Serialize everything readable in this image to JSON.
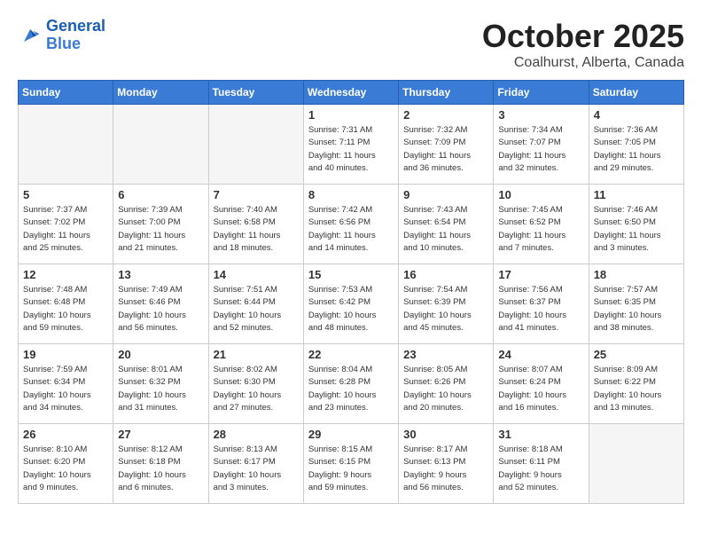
{
  "header": {
    "logo_line1": "General",
    "logo_line2": "Blue",
    "month": "October 2025",
    "location": "Coalhurst, Alberta, Canada"
  },
  "weekdays": [
    "Sunday",
    "Monday",
    "Tuesday",
    "Wednesday",
    "Thursday",
    "Friday",
    "Saturday"
  ],
  "weeks": [
    [
      {
        "day": "",
        "info": ""
      },
      {
        "day": "",
        "info": ""
      },
      {
        "day": "",
        "info": ""
      },
      {
        "day": "1",
        "info": "Sunrise: 7:31 AM\nSunset: 7:11 PM\nDaylight: 11 hours\nand 40 minutes."
      },
      {
        "day": "2",
        "info": "Sunrise: 7:32 AM\nSunset: 7:09 PM\nDaylight: 11 hours\nand 36 minutes."
      },
      {
        "day": "3",
        "info": "Sunrise: 7:34 AM\nSunset: 7:07 PM\nDaylight: 11 hours\nand 32 minutes."
      },
      {
        "day": "4",
        "info": "Sunrise: 7:36 AM\nSunset: 7:05 PM\nDaylight: 11 hours\nand 29 minutes."
      }
    ],
    [
      {
        "day": "5",
        "info": "Sunrise: 7:37 AM\nSunset: 7:02 PM\nDaylight: 11 hours\nand 25 minutes."
      },
      {
        "day": "6",
        "info": "Sunrise: 7:39 AM\nSunset: 7:00 PM\nDaylight: 11 hours\nand 21 minutes."
      },
      {
        "day": "7",
        "info": "Sunrise: 7:40 AM\nSunset: 6:58 PM\nDaylight: 11 hours\nand 18 minutes."
      },
      {
        "day": "8",
        "info": "Sunrise: 7:42 AM\nSunset: 6:56 PM\nDaylight: 11 hours\nand 14 minutes."
      },
      {
        "day": "9",
        "info": "Sunrise: 7:43 AM\nSunset: 6:54 PM\nDaylight: 11 hours\nand 10 minutes."
      },
      {
        "day": "10",
        "info": "Sunrise: 7:45 AM\nSunset: 6:52 PM\nDaylight: 11 hours\nand 7 minutes."
      },
      {
        "day": "11",
        "info": "Sunrise: 7:46 AM\nSunset: 6:50 PM\nDaylight: 11 hours\nand 3 minutes."
      }
    ],
    [
      {
        "day": "12",
        "info": "Sunrise: 7:48 AM\nSunset: 6:48 PM\nDaylight: 10 hours\nand 59 minutes."
      },
      {
        "day": "13",
        "info": "Sunrise: 7:49 AM\nSunset: 6:46 PM\nDaylight: 10 hours\nand 56 minutes."
      },
      {
        "day": "14",
        "info": "Sunrise: 7:51 AM\nSunset: 6:44 PM\nDaylight: 10 hours\nand 52 minutes."
      },
      {
        "day": "15",
        "info": "Sunrise: 7:53 AM\nSunset: 6:42 PM\nDaylight: 10 hours\nand 48 minutes."
      },
      {
        "day": "16",
        "info": "Sunrise: 7:54 AM\nSunset: 6:39 PM\nDaylight: 10 hours\nand 45 minutes."
      },
      {
        "day": "17",
        "info": "Sunrise: 7:56 AM\nSunset: 6:37 PM\nDaylight: 10 hours\nand 41 minutes."
      },
      {
        "day": "18",
        "info": "Sunrise: 7:57 AM\nSunset: 6:35 PM\nDaylight: 10 hours\nand 38 minutes."
      }
    ],
    [
      {
        "day": "19",
        "info": "Sunrise: 7:59 AM\nSunset: 6:34 PM\nDaylight: 10 hours\nand 34 minutes."
      },
      {
        "day": "20",
        "info": "Sunrise: 8:01 AM\nSunset: 6:32 PM\nDaylight: 10 hours\nand 31 minutes."
      },
      {
        "day": "21",
        "info": "Sunrise: 8:02 AM\nSunset: 6:30 PM\nDaylight: 10 hours\nand 27 minutes."
      },
      {
        "day": "22",
        "info": "Sunrise: 8:04 AM\nSunset: 6:28 PM\nDaylight: 10 hours\nand 23 minutes."
      },
      {
        "day": "23",
        "info": "Sunrise: 8:05 AM\nSunset: 6:26 PM\nDaylight: 10 hours\nand 20 minutes."
      },
      {
        "day": "24",
        "info": "Sunrise: 8:07 AM\nSunset: 6:24 PM\nDaylight: 10 hours\nand 16 minutes."
      },
      {
        "day": "25",
        "info": "Sunrise: 8:09 AM\nSunset: 6:22 PM\nDaylight: 10 hours\nand 13 minutes."
      }
    ],
    [
      {
        "day": "26",
        "info": "Sunrise: 8:10 AM\nSunset: 6:20 PM\nDaylight: 10 hours\nand 9 minutes."
      },
      {
        "day": "27",
        "info": "Sunrise: 8:12 AM\nSunset: 6:18 PM\nDaylight: 10 hours\nand 6 minutes."
      },
      {
        "day": "28",
        "info": "Sunrise: 8:13 AM\nSunset: 6:17 PM\nDaylight: 10 hours\nand 3 minutes."
      },
      {
        "day": "29",
        "info": "Sunrise: 8:15 AM\nSunset: 6:15 PM\nDaylight: 9 hours\nand 59 minutes."
      },
      {
        "day": "30",
        "info": "Sunrise: 8:17 AM\nSunset: 6:13 PM\nDaylight: 9 hours\nand 56 minutes."
      },
      {
        "day": "31",
        "info": "Sunrise: 8:18 AM\nSunset: 6:11 PM\nDaylight: 9 hours\nand 52 minutes."
      },
      {
        "day": "",
        "info": ""
      }
    ]
  ]
}
